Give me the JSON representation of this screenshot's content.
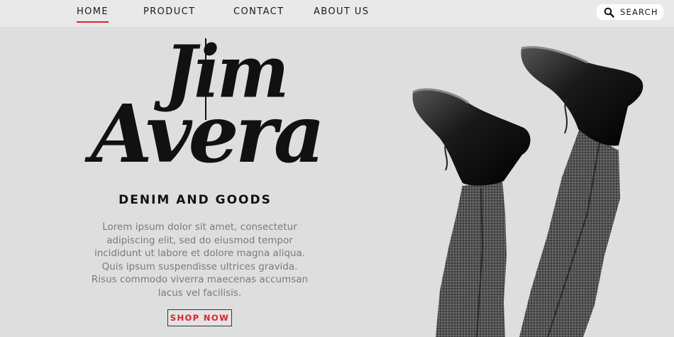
{
  "nav": {
    "items": [
      {
        "label": "HOME",
        "active": true
      },
      {
        "label": "PRODUCT",
        "active": false
      },
      {
        "label": "CONTACT",
        "active": false
      },
      {
        "label": "ABOUT US",
        "active": false
      }
    ],
    "search_label": "SEARCH",
    "search_icon": "search-icon"
  },
  "hero": {
    "brand_line1": "Jim",
    "brand_line2": "Avera",
    "tagline": "DENIM AND GOODS",
    "body": "Lorem ipsum dolor sit amet, consectetur adipiscing elit, sed do eiusmod tempor incididunt ut labore et dolore magna aliqua. Quis ipsum suspendisse ultrices gravida. Risus commodo viverra maecenas accumsan lacus vel facilisis.",
    "cta_label": "SHOP NOW"
  },
  "colors": {
    "accent": "#d9252d",
    "background": "#dedede",
    "topbar": "#e9e9e9",
    "body_text": "#7b7b7b"
  }
}
